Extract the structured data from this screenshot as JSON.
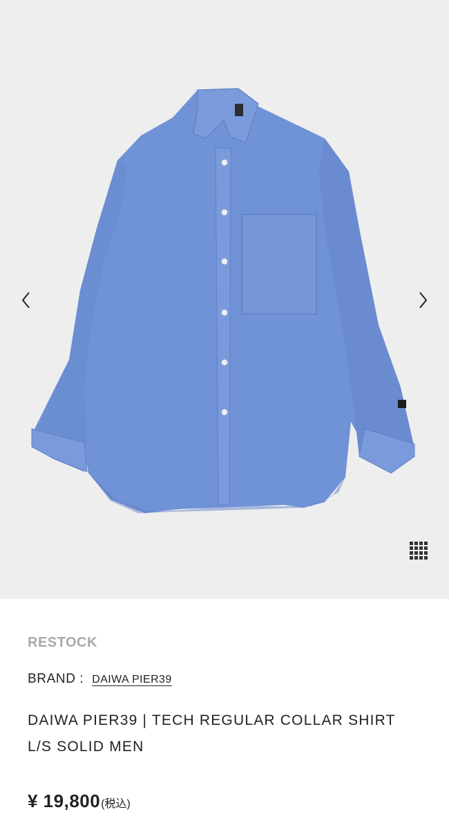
{
  "gallery": {
    "image_alt": "Blue long-sleeve regular collar shirt",
    "prev_icon": "chevron-left-icon",
    "next_icon": "chevron-right-icon",
    "grid_icon": "grid-icon"
  },
  "product": {
    "badge": "RESTOCK",
    "brand_label": "BRAND :",
    "brand_name": "DAIWA PIER39",
    "title": "DAIWA PIER39 | TECH REGULAR COLLAR SHIRT L/S SOLID MEN",
    "price": "¥ 19,800",
    "tax_note": "(税込)"
  },
  "colors": {
    "background": "#eeeeef",
    "shirt": "#7092d6",
    "badge_text": "#a9a9a9",
    "text": "#222222"
  }
}
